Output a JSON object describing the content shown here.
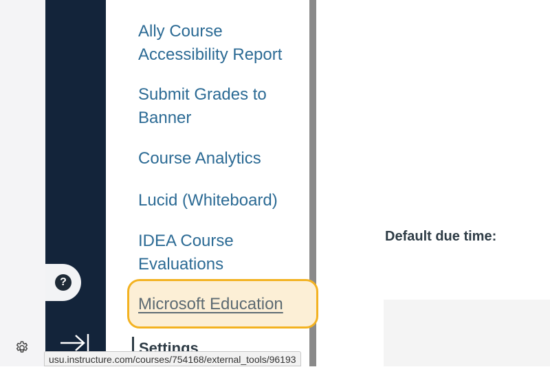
{
  "course_nav": {
    "items": [
      {
        "label_lines": [
          "Ally Course",
          "Accessibility Report"
        ]
      },
      {
        "label_lines": [
          "Submit Grades to",
          "Banner"
        ]
      },
      {
        "label_lines": [
          "Course Analytics"
        ]
      },
      {
        "label_lines": [
          "Lucid (Whiteboard)"
        ]
      },
      {
        "label_lines": [
          "IDEA Course",
          "Evaluations"
        ]
      }
    ],
    "focused_item": "Microsoft Education",
    "settings_label": "Settings"
  },
  "main": {
    "default_due_time_label": "Default due time:"
  },
  "status_bar": {
    "url": "usu.instructure.com/courses/754168/external_tools/96193"
  },
  "global_nav": {
    "help_icon": "question-circle-icon",
    "collapse_icon": "arrow-collapse-icon",
    "settings_icon": "gear-icon"
  },
  "colors": {
    "nav_dark": "#13243a",
    "link": "#2b6a94",
    "focus_ring": "#f3b221"
  }
}
